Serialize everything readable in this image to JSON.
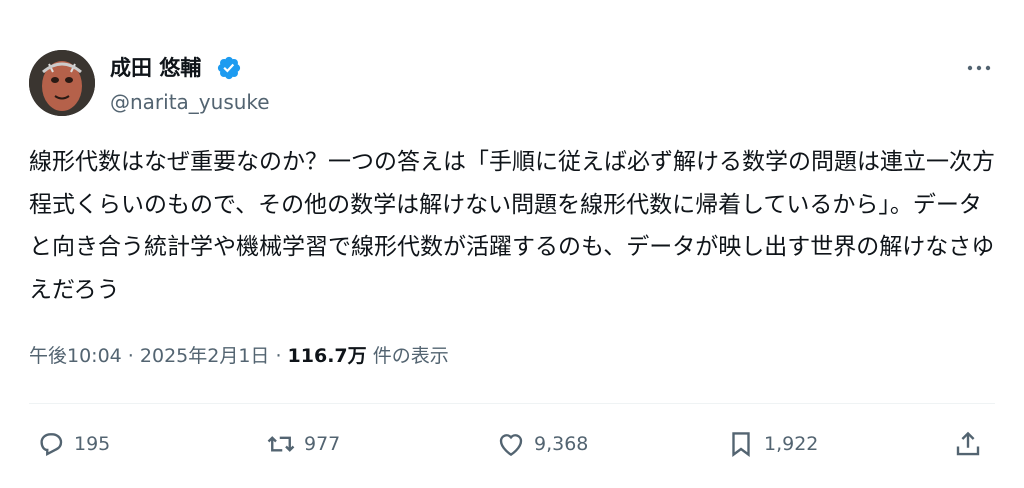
{
  "author": {
    "display_name": "成田 悠輔",
    "handle": "@narita_yusuke"
  },
  "tweet": {
    "text": "線形代数はなぜ重要なのか？一つの答えは「手順に従えば必ず解ける数学の問題は連立一次方程式くらいのもので、その他の数学は解けない問題を線形代数に帰着しているから」。データと向き合う統計学や機械学習で線形代数が活躍するのも、データが映し出す世界の解けなさゆえだろう"
  },
  "meta": {
    "time": "午後10:04",
    "sep1": " · ",
    "date": "2025年2月1日",
    "sep2": " · ",
    "views_count": "116.7万",
    "views_label": " 件の表示"
  },
  "actions": {
    "replies": "195",
    "reposts": "977",
    "likes": "9,368",
    "bookmarks": "1,922"
  },
  "colors": {
    "verified_badge": "#1d9bf0",
    "secondary_text": "#536471",
    "primary_text": "#0f1419"
  },
  "icons": [
    "verified-badge-icon",
    "more-icon",
    "reply-icon",
    "repost-icon",
    "like-icon",
    "bookmark-icon",
    "share-icon"
  ]
}
